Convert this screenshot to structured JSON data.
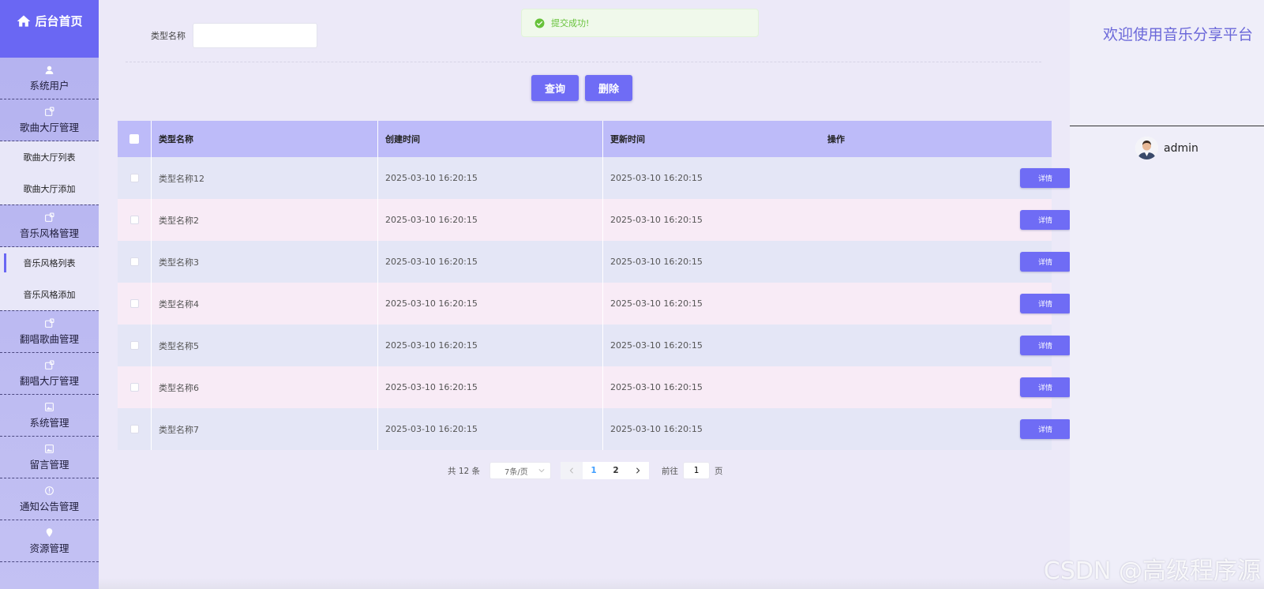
{
  "sidebar": {
    "brand": "后台首页",
    "groups": [
      {
        "label": "系统用户"
      },
      {
        "label": "歌曲大厅管理",
        "subs": [
          "歌曲大厅列表",
          "歌曲大厅添加"
        ]
      },
      {
        "label": "音乐风格管理",
        "subs": [
          "音乐风格列表",
          "音乐风格添加"
        ]
      },
      {
        "label": "翻唱歌曲管理"
      },
      {
        "label": "翻唱大厅管理"
      },
      {
        "label": "系统管理"
      },
      {
        "label": "留言管理"
      },
      {
        "label": "通知公告管理"
      },
      {
        "label": "资源管理"
      }
    ]
  },
  "toast": {
    "message": "提交成功!"
  },
  "search": {
    "label": "类型名称",
    "value": ""
  },
  "buttons": {
    "query": "查询",
    "delete": "删除"
  },
  "table": {
    "headers": {
      "name": "类型名称",
      "created": "创建时间",
      "updated": "更新时间",
      "op": "操作"
    },
    "rows": [
      {
        "name": "类型名称12",
        "created": "2025-03-10 16:20:15",
        "updated": "2025-03-10 16:20:15",
        "action": "详情"
      },
      {
        "name": "类型名称2",
        "created": "2025-03-10 16:20:15",
        "updated": "2025-03-10 16:20:15",
        "action": "详情"
      },
      {
        "name": "类型名称3",
        "created": "2025-03-10 16:20:15",
        "updated": "2025-03-10 16:20:15",
        "action": "详情"
      },
      {
        "name": "类型名称4",
        "created": "2025-03-10 16:20:15",
        "updated": "2025-03-10 16:20:15",
        "action": "详情"
      },
      {
        "name": "类型名称5",
        "created": "2025-03-10 16:20:15",
        "updated": "2025-03-10 16:20:15",
        "action": "详情"
      },
      {
        "name": "类型名称6",
        "created": "2025-03-10 16:20:15",
        "updated": "2025-03-10 16:20:15",
        "action": "详情"
      },
      {
        "name": "类型名称7",
        "created": "2025-03-10 16:20:15",
        "updated": "2025-03-10 16:20:15",
        "action": "详情"
      }
    ]
  },
  "pagination": {
    "total": "共 12 条",
    "page_size": "7条/页",
    "pages": [
      "1",
      "2"
    ],
    "goto_label": "前往",
    "goto_value": "1",
    "goto_suffix": "页"
  },
  "header": {
    "welcome": "欢迎使用音乐分享平台",
    "username": "admin"
  },
  "watermark": "CSDN @高级程序源",
  "colors": {
    "accent": "#6f6cf5",
    "brand": "#6a67f3",
    "table_header": "#bdbbf9",
    "success": "#67c23a"
  }
}
